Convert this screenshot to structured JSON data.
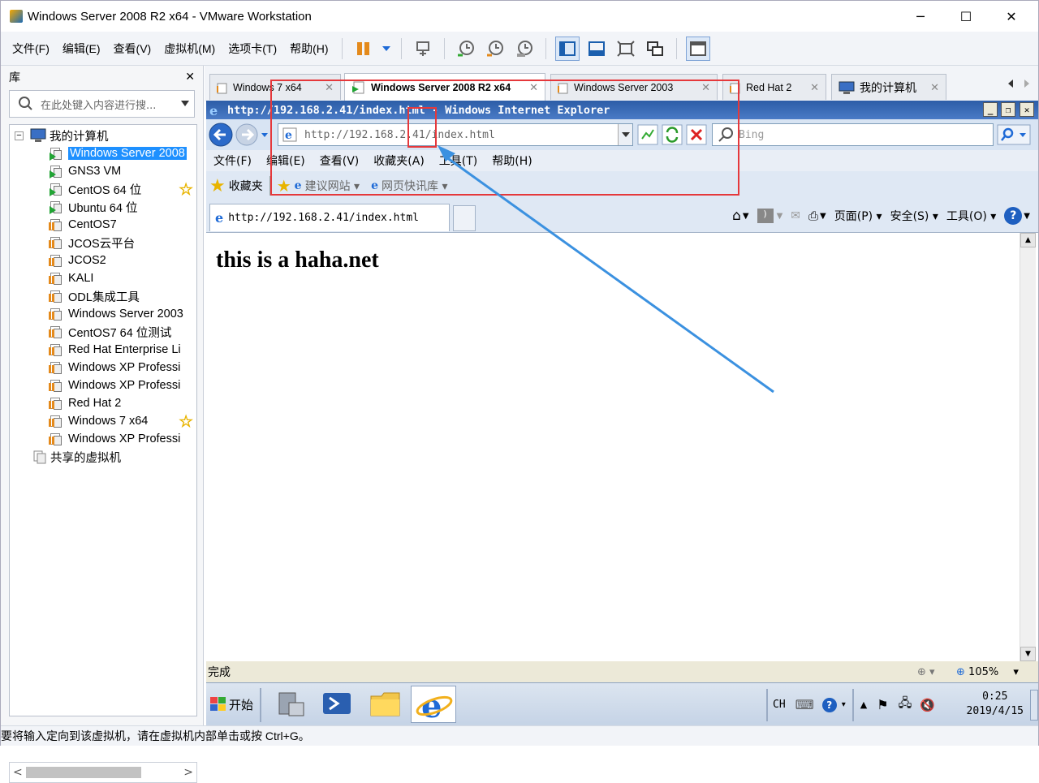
{
  "window": {
    "title": "Windows Server 2008 R2 x64 - VMware Workstation",
    "controls": {
      "minimize": "─",
      "maximize": "☐",
      "close": "✕"
    }
  },
  "menu": [
    "文件(F)",
    "编辑(E)",
    "查看(V)",
    "虚拟机(M)",
    "选项卡(T)",
    "帮助(H)"
  ],
  "library": {
    "title": "库",
    "close": "✕",
    "search_placeholder": "在此处键入内容进行搜...",
    "root": "我的计算机",
    "shared": "共享的虚拟机",
    "items": [
      "Windows Server 2008",
      "GNS3 VM",
      "CentOS 64 位",
      "Ubuntu 64 位",
      "CentOS7",
      "JCOS云平台",
      "JCOS2",
      "KALI",
      "ODL集成工具",
      "Windows Server 2003",
      "CentOS7 64 位测试",
      "Red Hat Enterprise Li",
      "Windows XP Professi",
      "Windows XP Professi",
      "Red Hat 2",
      "Windows 7 x64",
      "Windows XP Professi"
    ],
    "scroll_left": "<",
    "scroll_right": ">"
  },
  "tabs": [
    "Windows 7 x64",
    "Windows Server 2008 R2 x64",
    "Windows Server 2003",
    "Red Hat 2",
    "我的计算机"
  ],
  "tab_close": "✕",
  "ie": {
    "title": "http://192.168.2.41/index.html - Windows Internet Explorer",
    "address": "http://192.168.2.41/index.html",
    "search": "Bing",
    "menu": [
      "文件(F)",
      "编辑(E)",
      "查看(V)",
      "收藏夹(A)",
      "工具(T)",
      "帮助(H)"
    ],
    "favorites": "收藏夹",
    "fav1": "建议网站 ▾",
    "fav2": "网页快讯库 ▾",
    "pagetab": "http://192.168.2.41/index.html",
    "cmds": {
      "page": "页面(P) ▾",
      "safety": "安全(S) ▾",
      "tools": "工具(O) ▾"
    },
    "heading": "this is a haha.net",
    "status": "完成",
    "zoom": "105%"
  },
  "taskbar": {
    "start": "开始",
    "lang": "CH",
    "time": "0:25",
    "date": "2019/4/15"
  },
  "statusbar": "要将输入定向到该虚拟机，请在虚拟机内部单击或按 Ctrl+G。"
}
